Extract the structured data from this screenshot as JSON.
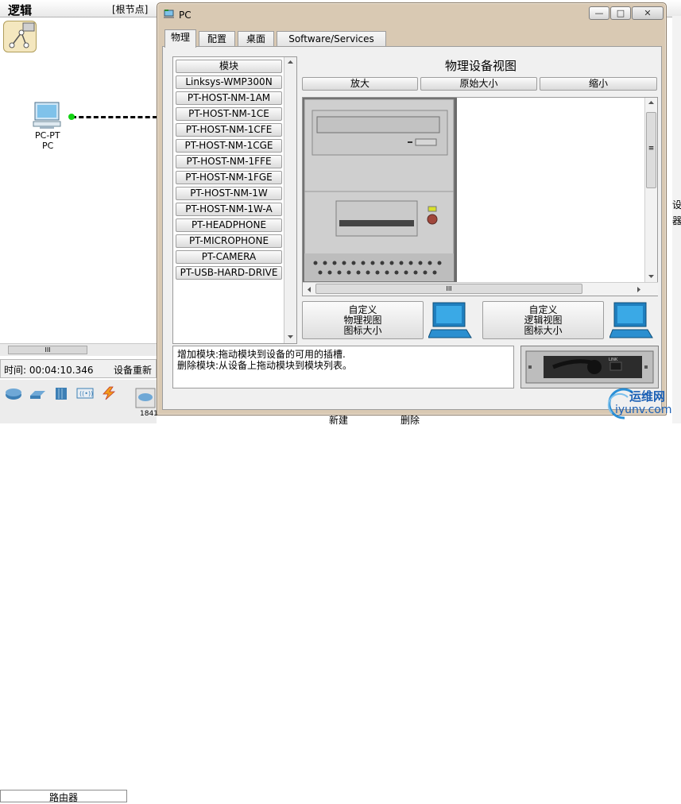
{
  "background": {
    "workspace_title": "逻辑",
    "root_label": "[根节点]",
    "pc_label_line1": "PC-PT",
    "pc_label_line2": "PC",
    "scroll_glyph": "III",
    "time_label": "时间: 00:04:10.346",
    "reset_label": "设备重新",
    "device_category": "路由器",
    "router_partial_label": "1841",
    "right_edge_text_1": "设",
    "right_edge_text_2": "器"
  },
  "dialog": {
    "title": "PC",
    "window_buttons": {
      "minimize": "—",
      "maximize": "□",
      "close": "✕"
    },
    "tabs": [
      {
        "label": "物理",
        "active": true
      },
      {
        "label": "配置",
        "active": false
      },
      {
        "label": "桌面",
        "active": false
      },
      {
        "label": "Software/Services",
        "active": false
      }
    ],
    "module_list": {
      "header": "模块",
      "items": [
        "Linksys-WMP300N",
        "PT-HOST-NM-1AM",
        "PT-HOST-NM-1CE",
        "PT-HOST-NM-1CFE",
        "PT-HOST-NM-1CGE",
        "PT-HOST-NM-1FFE",
        "PT-HOST-NM-1FGE",
        "PT-HOST-NM-1W",
        "PT-HOST-NM-1W-A",
        "PT-HEADPHONE",
        "PT-MICROPHONE",
        "PT-CAMERA",
        "PT-USB-HARD-DRIVE"
      ]
    },
    "physical_view": {
      "title": "物理设备视图",
      "zoom_in": "放大",
      "original_size": "原始大小",
      "zoom_out": "缩小",
      "scroll_glyph": "III",
      "vscroll_glyph": "≡"
    },
    "custom_physical": {
      "line1": "自定义",
      "line2": "物理视图",
      "line3": "图标大小"
    },
    "custom_logical": {
      "line1": "自定义",
      "line2": "逻辑视图",
      "line3": "图标大小"
    },
    "info": {
      "line1": "增加模块:拖动模块到设备的可用的插槽.",
      "line2": "删除模块:从设备上拖动模块到模块列表。"
    },
    "module_preview_label": "LINK"
  },
  "bottom": {
    "add": "新建",
    "delete": "删除"
  },
  "watermark": {
    "line1": "运维网",
    "line2": "iyunv.com"
  },
  "colors": {
    "dialog_frame": "#d9c9b3",
    "panel_bg": "#f0f0f0",
    "link_dot": "#12d312",
    "watermark_blue": "#1a5fb4"
  }
}
